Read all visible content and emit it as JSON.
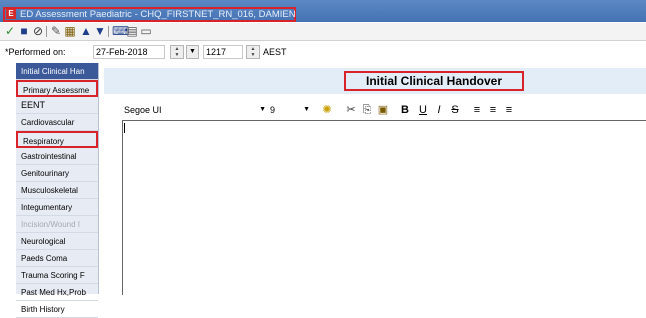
{
  "window": {
    "app_icon_letter": "E",
    "title": "ED Assessment Paediatric - CHQ_FIRSTNET_RN_016, DAMIEN"
  },
  "toolbar": {
    "icons": [
      "check-icon",
      "save-icon",
      "cancel-icon",
      "tools-icon",
      "calculator-icon",
      "up-arrow-icon",
      "down-arrow-icon",
      "keyboard-icon",
      "grid-icon",
      "document-icon"
    ]
  },
  "performed": {
    "label": "*Performed on:",
    "date": "27-Feb-2018",
    "time": "1217",
    "timezone": "AEST"
  },
  "sidebar": {
    "items": [
      {
        "label": "Initial Clinical Han"
      },
      {
        "label": "Primary Assessme"
      },
      {
        "label": "EENT"
      },
      {
        "label": "Cardiovascular"
      },
      {
        "label": "Respiratory"
      },
      {
        "label": "Gastrointestinal"
      },
      {
        "label": "Genitourinary"
      },
      {
        "label": "Musculoskeletal"
      },
      {
        "label": "Integumentary"
      },
      {
        "label": "Incision/Wound I"
      },
      {
        "label": "Neurological"
      },
      {
        "label": "Paeds Coma"
      },
      {
        "label": "Trauma Scoring F"
      },
      {
        "label": "Past Med Hx,Prob"
      },
      {
        "label": "Birth History"
      }
    ]
  },
  "section": {
    "title": "Initial Clinical Handover"
  },
  "format_bar": {
    "font": "Segoe UI",
    "size": "9",
    "bold": "B",
    "underline": "U",
    "italic": "I",
    "strike": "S"
  }
}
